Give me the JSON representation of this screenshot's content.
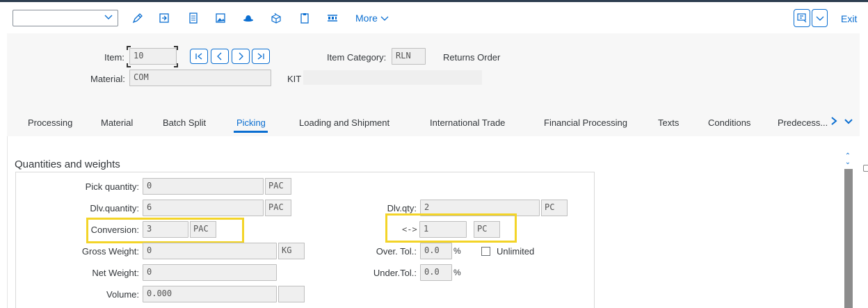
{
  "toolbar": {
    "dropdown_value": "",
    "more_label": "More",
    "exit_label": "Exit"
  },
  "header": {
    "item_label": "Item:",
    "item_value": "10",
    "material_label": "Material:",
    "material_value": "COM",
    "item_category_label": "Item Category:",
    "item_category_value": "RLN",
    "item_category_text": "Returns Order",
    "material_desc": "KIT"
  },
  "tabs": [
    {
      "label": "Processing"
    },
    {
      "label": "Material"
    },
    {
      "label": "Batch Split"
    },
    {
      "label": "Picking"
    },
    {
      "label": "Loading and Shipment"
    },
    {
      "label": "International Trade"
    },
    {
      "label": "Financial Processing"
    },
    {
      "label": "Texts"
    },
    {
      "label": "Conditions"
    },
    {
      "label": "Predecess..."
    }
  ],
  "section": {
    "title": "Quantities and weights",
    "pick_quantity_label": "Pick quantity:",
    "pick_quantity_value": "0",
    "pick_quantity_unit": "PAC",
    "dlv_quantity_label": "Dlv.quantity:",
    "dlv_quantity_value": "6",
    "dlv_quantity_unit": "PAC",
    "conversion_label": "Conversion:",
    "conversion_value": "3",
    "conversion_unit": "PAC",
    "gross_weight_label": "Gross Weight:",
    "gross_weight_value": "0",
    "gross_weight_unit": "KG",
    "net_weight_label": "Net Weight:",
    "net_weight_value": "0",
    "volume_label": "Volume:",
    "volume_value": "0.000",
    "volume_unit": "",
    "dlv_qty_label": "Dlv.qty:",
    "dlv_qty_value": "2",
    "dlv_qty_unit": "PC",
    "conv_arrow_label": "<->",
    "conv_right_value": "1",
    "conv_right_unit": "PC",
    "over_tol_label": "Over. Tol.:",
    "over_tol_value": "0.0",
    "over_tol_unit": "%",
    "unlimited_label": "Unlimited",
    "under_tol_label": "Under.Tol.:",
    "under_tol_value": "0.0",
    "under_tol_unit": "%"
  },
  "colors": {
    "accent": "#0a6ed1",
    "highlight": "#f3d428"
  }
}
